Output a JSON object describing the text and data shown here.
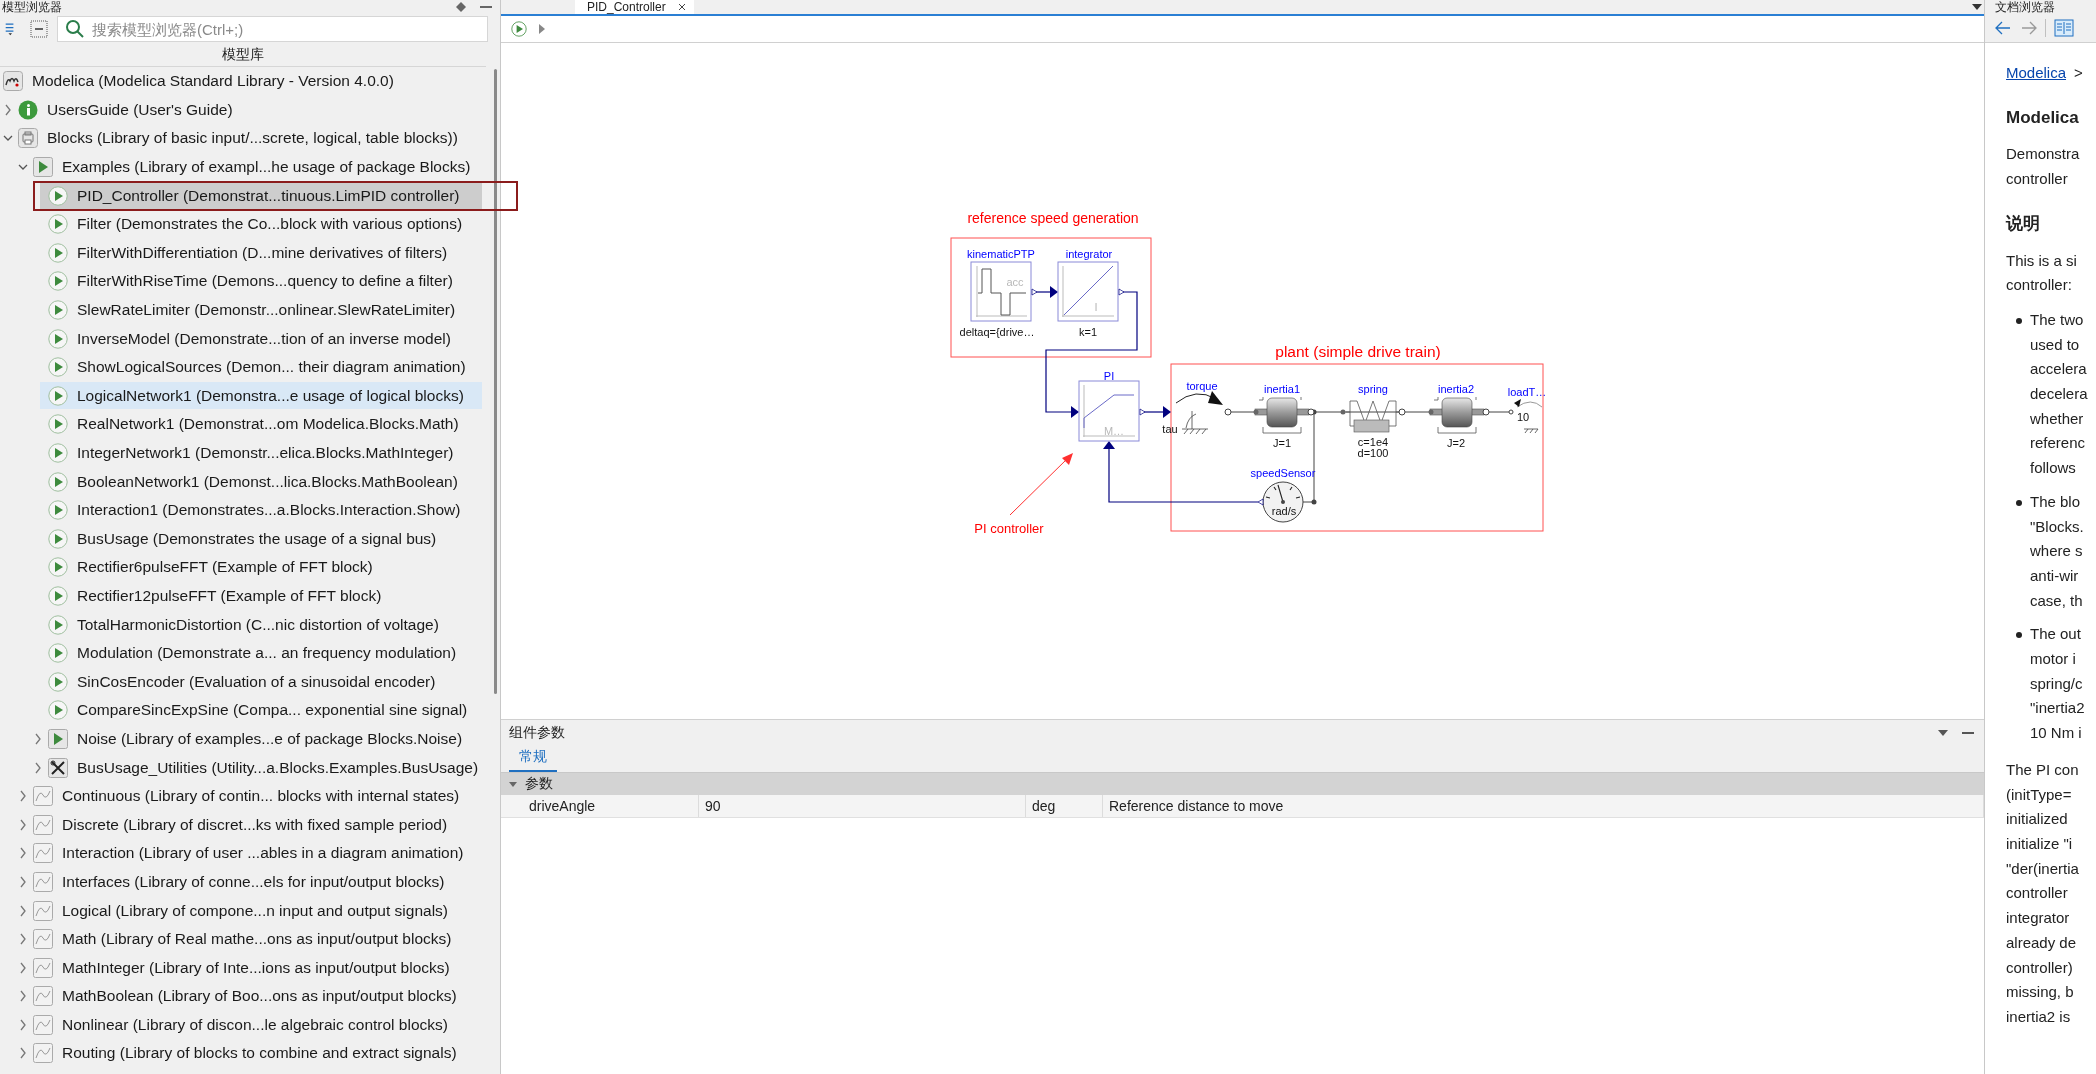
{
  "model_browser": {
    "title": "模型浏览器",
    "search": {
      "placeholder": "搜索模型浏览器(Ctrl+;)"
    },
    "header": "模型库",
    "items": [
      {
        "label": "Modelica (Modelica Standard Library - Version 4.0.0)",
        "kind": "root",
        "selected": false,
        "hovered": false,
        "children": [
          {
            "label": "UsersGuide (User's Guide)",
            "kind": "info",
            "expanded": false,
            "selected": false,
            "hovered": false
          },
          {
            "label": "Blocks (Library of basic input/...screte, logical, table blocks))",
            "kind": "package",
            "expanded": true,
            "selected": false,
            "hovered": false,
            "children": [
              {
                "label": "Examples (Library of exampl...he usage of package Blocks)",
                "kind": "example-package",
                "expanded": true,
                "selected": false,
                "hovered": false,
                "children": [
                  {
                    "label": "PID_Controller (Demonstrat...tinuous.LimPID controller)",
                    "kind": "example",
                    "selected": true,
                    "hovered": false
                  },
                  {
                    "label": "Filter (Demonstrates the Co...block with various options)",
                    "kind": "example",
                    "selected": false,
                    "hovered": false
                  },
                  {
                    "label": "FilterWithDifferentiation (D...mine derivatives of filters)",
                    "kind": "example",
                    "selected": false,
                    "hovered": false
                  },
                  {
                    "label": "FilterWithRiseTime (Demons...quency to define a filter)",
                    "kind": "example",
                    "selected": false,
                    "hovered": false
                  },
                  {
                    "label": "SlewRateLimiter (Demonstr...onlinear.SlewRateLimiter)",
                    "kind": "example",
                    "selected": false,
                    "hovered": false
                  },
                  {
                    "label": "InverseModel (Demonstrate...tion of an inverse model)",
                    "kind": "example",
                    "selected": false,
                    "hovered": false
                  },
                  {
                    "label": "ShowLogicalSources (Demon... their diagram animation)",
                    "kind": "example",
                    "selected": false,
                    "hovered": false
                  },
                  {
                    "label": "LogicalNetwork1 (Demonstra...e usage of logical blocks)",
                    "kind": "example",
                    "selected": false,
                    "hovered": true
                  },
                  {
                    "label": "RealNetwork1 (Demonstrat...om Modelica.Blocks.Math)",
                    "kind": "example",
                    "selected": false,
                    "hovered": false
                  },
                  {
                    "label": "IntegerNetwork1 (Demonstr...elica.Blocks.MathInteger)",
                    "kind": "example",
                    "selected": false,
                    "hovered": false
                  },
                  {
                    "label": "BooleanNetwork1 (Demonst...lica.Blocks.MathBoolean)",
                    "kind": "example",
                    "selected": false,
                    "hovered": false
                  },
                  {
                    "label": "Interaction1 (Demonstrates...a.Blocks.Interaction.Show)",
                    "kind": "example",
                    "selected": false,
                    "hovered": false
                  },
                  {
                    "label": "BusUsage (Demonstrates the usage of a signal bus)",
                    "kind": "example",
                    "selected": false,
                    "hovered": false
                  },
                  {
                    "label": "Rectifier6pulseFFT (Example of FFT block)",
                    "kind": "example",
                    "selected": false,
                    "hovered": false
                  },
                  {
                    "label": "Rectifier12pulseFFT (Example of FFT block)",
                    "kind": "example",
                    "selected": false,
                    "hovered": false
                  },
                  {
                    "label": "TotalHarmonicDistortion (C...nic distortion of voltage)",
                    "kind": "example",
                    "selected": false,
                    "hovered": false
                  },
                  {
                    "label": "Modulation (Demonstrate a... an frequency modulation)",
                    "kind": "example",
                    "selected": false,
                    "hovered": false
                  },
                  {
                    "label": "SinCosEncoder (Evaluation of a sinusoidal encoder)",
                    "kind": "example",
                    "selected": false,
                    "hovered": false
                  },
                  {
                    "label": "CompareSincExpSine (Compa... exponential sine signal)",
                    "kind": "example",
                    "selected": false,
                    "hovered": false
                  },
                  {
                    "label": "Noise (Library of examples...e of package Blocks.Noise)",
                    "kind": "example-package",
                    "expanded": false,
                    "selected": false,
                    "hovered": false
                  },
                  {
                    "label": "BusUsage_Utilities (Utility...a.Blocks.Examples.BusUsage)",
                    "kind": "utility",
                    "expanded": false,
                    "selected": false,
                    "hovered": false
                  }
                ]
              },
              {
                "label": "Continuous (Library of contin... blocks with internal states)",
                "kind": "library",
                "expanded": false,
                "selected": false,
                "hovered": false
              },
              {
                "label": "Discrete (Library of discret...ks with fixed sample period)",
                "kind": "library",
                "expanded": false,
                "selected": false,
                "hovered": false
              },
              {
                "label": "Interaction (Library of user ...ables in a diagram animation)",
                "kind": "library",
                "expanded": false,
                "selected": false,
                "hovered": false
              },
              {
                "label": "Interfaces (Library of conne...els for input/output blocks)",
                "kind": "library",
                "expanded": false,
                "selected": false,
                "hovered": false
              },
              {
                "label": "Logical (Library of compone...n input and output signals)",
                "kind": "library",
                "expanded": false,
                "selected": false,
                "hovered": false
              },
              {
                "label": "Math (Library of Real mathe...ons as input/output blocks)",
                "kind": "library",
                "expanded": false,
                "selected": false,
                "hovered": false
              },
              {
                "label": "MathInteger (Library of Inte...ions as input/output blocks)",
                "kind": "library",
                "expanded": false,
                "selected": false,
                "hovered": false
              },
              {
                "label": "MathBoolean (Library of Boo...ons as input/output blocks)",
                "kind": "library",
                "expanded": false,
                "selected": false,
                "hovered": false
              },
              {
                "label": "Nonlinear (Library of discon...le algebraic control blocks)",
                "kind": "library",
                "expanded": false,
                "selected": false,
                "hovered": false
              },
              {
                "label": "Routing (Library of blocks to combine and extract signals)",
                "kind": "library",
                "expanded": false,
                "selected": false,
                "hovered": false
              }
            ]
          }
        ]
      }
    ]
  },
  "editor": {
    "tabs": [
      {
        "label": "PID_Controller",
        "selected": true
      }
    ],
    "diagram": {
      "groups": [
        {
          "title": "reference speed generation"
        },
        {
          "title": "plant (simple drive train)"
        }
      ],
      "callout": "PI controller",
      "components": [
        {
          "kind": "kinematic",
          "label": "kinematicPTP",
          "icon_text": "acc",
          "params": [
            "deltaq={drive…"
          ]
        },
        {
          "kind": "integrator",
          "label": "integrator",
          "icon_text": "I",
          "params": [
            "k=1"
          ]
        },
        {
          "kind": "limiter",
          "label": "PI",
          "icon_text": "M…"
        },
        {
          "kind": "torque",
          "label": "torque",
          "params": [
            "tau"
          ]
        },
        {
          "kind": "inertia1",
          "label": "inertia1",
          "params": [
            "J=1"
          ]
        },
        {
          "kind": "spring",
          "label": "spring",
          "params": [
            "c=1e4",
            "d=100"
          ]
        },
        {
          "kind": "inertia2",
          "label": "inertia2",
          "params": [
            "J=2"
          ]
        },
        {
          "kind": "load",
          "label": "loadT…",
          "params": [
            "10"
          ]
        },
        {
          "kind": "sensor",
          "label": "speedSensor",
          "params": [
            "rad/s"
          ]
        }
      ]
    }
  },
  "parameters": {
    "title": "组件参数",
    "tabs": [
      {
        "label": "常规",
        "selected": true
      }
    ],
    "groups": [
      {
        "name": "参数",
        "expanded": true,
        "rows": [
          {
            "name": "driveAngle",
            "value": "90",
            "unit": "deg",
            "description": "Reference distance to move"
          }
        ]
      }
    ]
  },
  "documentation": {
    "title": "文档浏览器",
    "breadcrumb": "Modelica",
    "separator": ">",
    "heading": "Modelica",
    "summary": [
      "Demonstra",
      "controller"
    ],
    "section": "说明",
    "intro": [
      "This is a si",
      "controller:"
    ],
    "bullets": [
      [
        "The two",
        "used to",
        "accelera",
        "decelera",
        "whether",
        "referenc",
        "follows"
      ],
      [
        "The blo",
        "\"Blocks.",
        "where s",
        "anti-wir",
        "case, th"
      ],
      [
        "The out",
        "motor i",
        "spring/c",
        "\"inertia2",
        "10 Nm i"
      ]
    ],
    "paragraph": [
      "The PI con",
      "(initType=",
      "initialized",
      "initialize \"i",
      "\"der(inertia",
      "controller",
      "integrator",
      "already de",
      "controller)",
      "missing, b",
      "inertia2 is"
    ]
  }
}
